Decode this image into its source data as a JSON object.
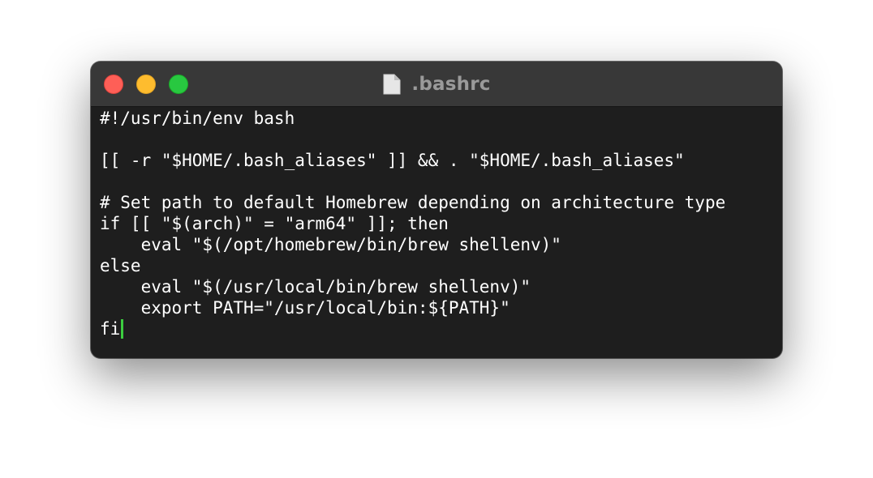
{
  "window": {
    "title": ".bashrc",
    "title_icon": "document-icon"
  },
  "colors": {
    "terminal_background": "#1e1e1e",
    "titlebar_background": "#383838",
    "text": "#ffffff",
    "cursor": "#3ccc3f",
    "close": "#fe5f57",
    "minimize": "#febc2e",
    "zoom": "#28c840"
  },
  "editor": {
    "lines": [
      "#!/usr/bin/env bash",
      "",
      "[[ -r \"$HOME/.bash_aliases\" ]] && . \"$HOME/.bash_aliases\"",
      "",
      "# Set path to default Homebrew depending on architecture type",
      "if [[ \"$(arch)\" = \"arm64\" ]]; then",
      "    eval \"$(/opt/homebrew/bin/brew shellenv)\"",
      "else",
      "    eval \"$(/usr/local/bin/brew shellenv)\"",
      "    export PATH=\"/usr/local/bin:${PATH}\"",
      "fi"
    ]
  }
}
